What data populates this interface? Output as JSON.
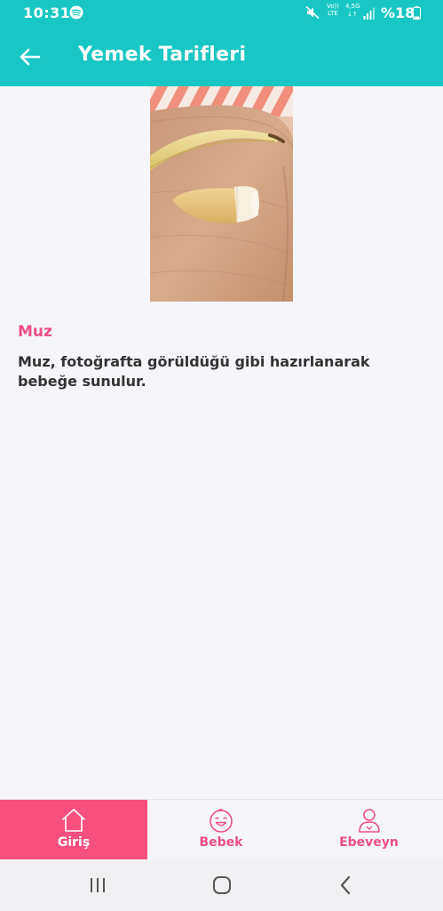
{
  "status": {
    "time": "10:31",
    "volte_top": "Vo))",
    "volte_bottom": "LTE",
    "net_top": "4,5G",
    "net_bottom": "↓↑",
    "battery": "%18"
  },
  "header": {
    "title": "Yemek Tarifleri"
  },
  "recipe": {
    "name": "Muz",
    "description": "Muz, fotoğrafta görüldüğü gibi hazırlanarak bebeğe sunulur."
  },
  "bottom_nav": {
    "items": [
      {
        "label": "Giriş",
        "icon": "home-icon",
        "active": true
      },
      {
        "label": "Bebek",
        "icon": "baby-face-icon",
        "active": false
      },
      {
        "label": "Ebeveyn",
        "icon": "parent-icon",
        "active": false
      }
    ]
  },
  "colors": {
    "primary": "#18c7c5",
    "accent": "#f8507e",
    "accent_text": "#ec4f86",
    "background": "#f6f5fa"
  }
}
